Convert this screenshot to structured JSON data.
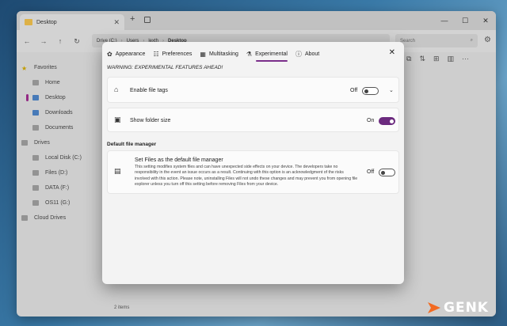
{
  "window": {
    "tab_title": "Desktop",
    "new_tab": "+",
    "controls": {
      "minimize": "—",
      "maximize": "☐",
      "close": "✕"
    }
  },
  "toolbar": {
    "breadcrumb": [
      "Drive (C:)",
      "Users",
      "lexth",
      "Desktop"
    ],
    "search_placeholder": "Search"
  },
  "sidebar": {
    "favorites": "Favorites",
    "home": "Home",
    "desktop": "Desktop",
    "downloads": "Downloads",
    "documents": "Documents",
    "drives": "Drives",
    "local_disk": "Local Disk (C:)",
    "files_d": "Files (D:)",
    "data_f": "DATA (F:)",
    "os11_g": "OS11 (G:)",
    "cloud_drives": "Cloud Drives"
  },
  "status": {
    "items_count": "2 items"
  },
  "settings": {
    "tabs": [
      {
        "label": "Appearance",
        "icon": "palette-icon",
        "glyph": "✿"
      },
      {
        "label": "Preferences",
        "icon": "sliders-icon",
        "glyph": "☷"
      },
      {
        "label": "Multitasking",
        "icon": "multitask-icon",
        "glyph": "▦"
      },
      {
        "label": "Experimental",
        "icon": "flask-icon",
        "glyph": "⚗"
      },
      {
        "label": "About",
        "icon": "info-icon",
        "glyph": "ⓘ"
      }
    ],
    "active_tab": "Experimental",
    "close": "✕",
    "warning": "WARNING: EXPERIMENTAL FEATURES AHEAD!",
    "file_tags": {
      "label": "Enable file tags",
      "state": "Off",
      "on": false
    },
    "folder_size": {
      "label": "Show folder size",
      "state": "On",
      "on": true
    },
    "section_title": "Default file manager",
    "default_manager": {
      "title": "Set Files as the default file manager",
      "description": "This setting modifies system files and can have unexpected side effects on your device. The developers take no responsibility in the event an issue occurs as a result. Continuing with this option is an acknowledgment of the risks involved with this action. Please note, uninstalling Files will not undo these changes and may prevent you from opening file explorer unless you turn off this setting before removing Files from your device.",
      "state": "Off",
      "on": false
    }
  },
  "watermark": {
    "text": "GENK"
  },
  "colors": {
    "accent": "#6b2a7e",
    "watermark_orange": "#f26a21"
  }
}
